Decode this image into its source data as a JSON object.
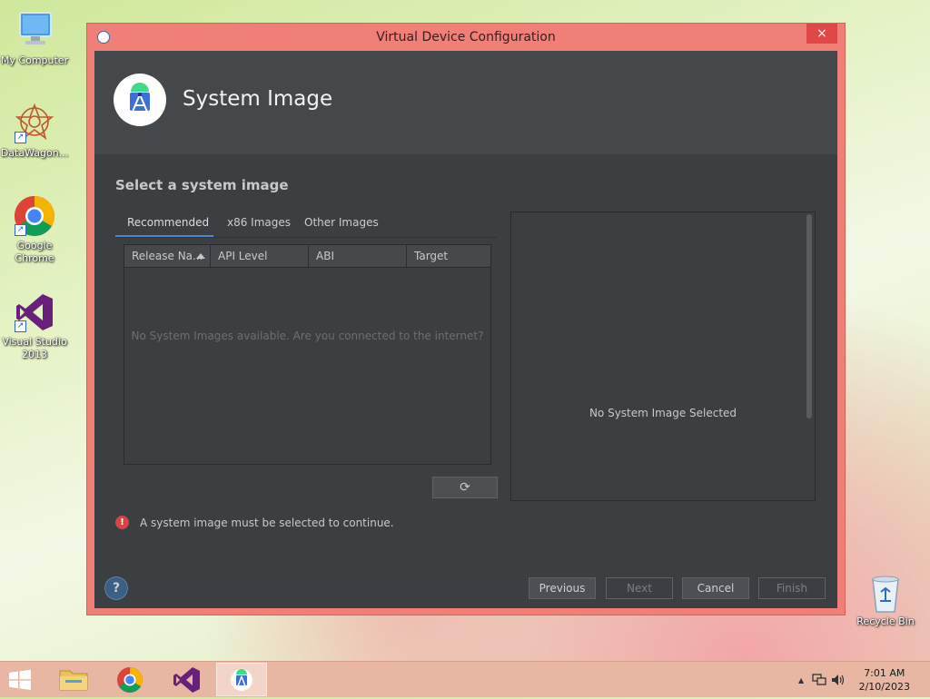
{
  "desktop": {
    "icons": [
      {
        "label": "My Computer"
      },
      {
        "label": "DataWagon..."
      },
      {
        "label": "Google Chrome"
      },
      {
        "label": "Visual Studio 2013"
      },
      {
        "label": "Recycle Bin"
      }
    ]
  },
  "window": {
    "title": "Virtual Device Configuration",
    "close_label": "×"
  },
  "header": {
    "page_title": "System Image"
  },
  "main": {
    "section_title": "Select a system image",
    "tabs": [
      {
        "label": "Recommended",
        "active": true
      },
      {
        "label": "x86 Images",
        "active": false
      },
      {
        "label": "Other Images",
        "active": false
      }
    ],
    "table": {
      "columns": [
        "Release Na...",
        "API Level",
        "ABI",
        "Target"
      ],
      "empty_message": "No System Images available. Are you connected to the internet?"
    },
    "refresh_label": "⟳",
    "detail_panel": {
      "message": "No System Image Selected"
    },
    "error": {
      "icon": "!",
      "message": "A system image must be selected to continue."
    }
  },
  "footer": {
    "help_label": "?",
    "buttons": {
      "previous": "Previous",
      "next": "Next",
      "cancel": "Cancel",
      "finish": "Finish"
    }
  },
  "taskbar": {
    "time": "7:01 AM",
    "date": "2/10/2023",
    "tray_up_arrow": "▲"
  },
  "colors": {
    "window_border": "#ef7f77",
    "dialog_bg": "#3c3f41",
    "header_bg": "#45484a",
    "tab_accent": "#4a88c7",
    "error_red": "#d64545"
  }
}
